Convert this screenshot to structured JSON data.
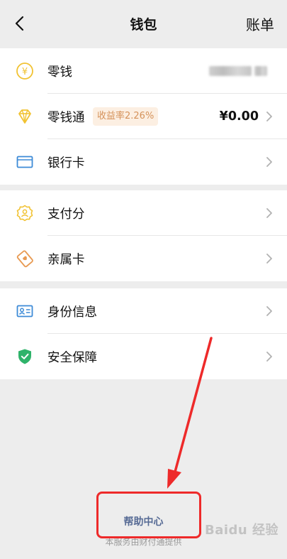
{
  "nav": {
    "title": "钱包",
    "bill_label": "账单"
  },
  "sections": [
    {
      "items": [
        {
          "label": "零钱",
          "icon": "yuan-coin-icon"
        },
        {
          "label": "零钱通",
          "icon": "diamond-icon",
          "badge": "收益率2.26%",
          "value": "¥0.00"
        },
        {
          "label": "银行卡",
          "icon": "bank-card-icon"
        }
      ]
    },
    {
      "items": [
        {
          "label": "支付分",
          "icon": "pay-score-icon"
        },
        {
          "label": "亲属卡",
          "icon": "family-card-icon"
        }
      ]
    },
    {
      "items": [
        {
          "label": "身份信息",
          "icon": "id-card-icon"
        },
        {
          "label": "安全保障",
          "icon": "shield-check-icon"
        }
      ]
    }
  ],
  "footer": {
    "help_link": "帮助中心",
    "note": "本服务由财付通提供"
  },
  "watermark": "Baidu 经验",
  "colors": {
    "accent_link": "#576b95",
    "icon_yellow": "#f1c232",
    "icon_blue": "#3d8bd7",
    "icon_orange": "#e89a52",
    "icon_green": "#2fb36a",
    "annotation_red": "#ee2a2a"
  }
}
